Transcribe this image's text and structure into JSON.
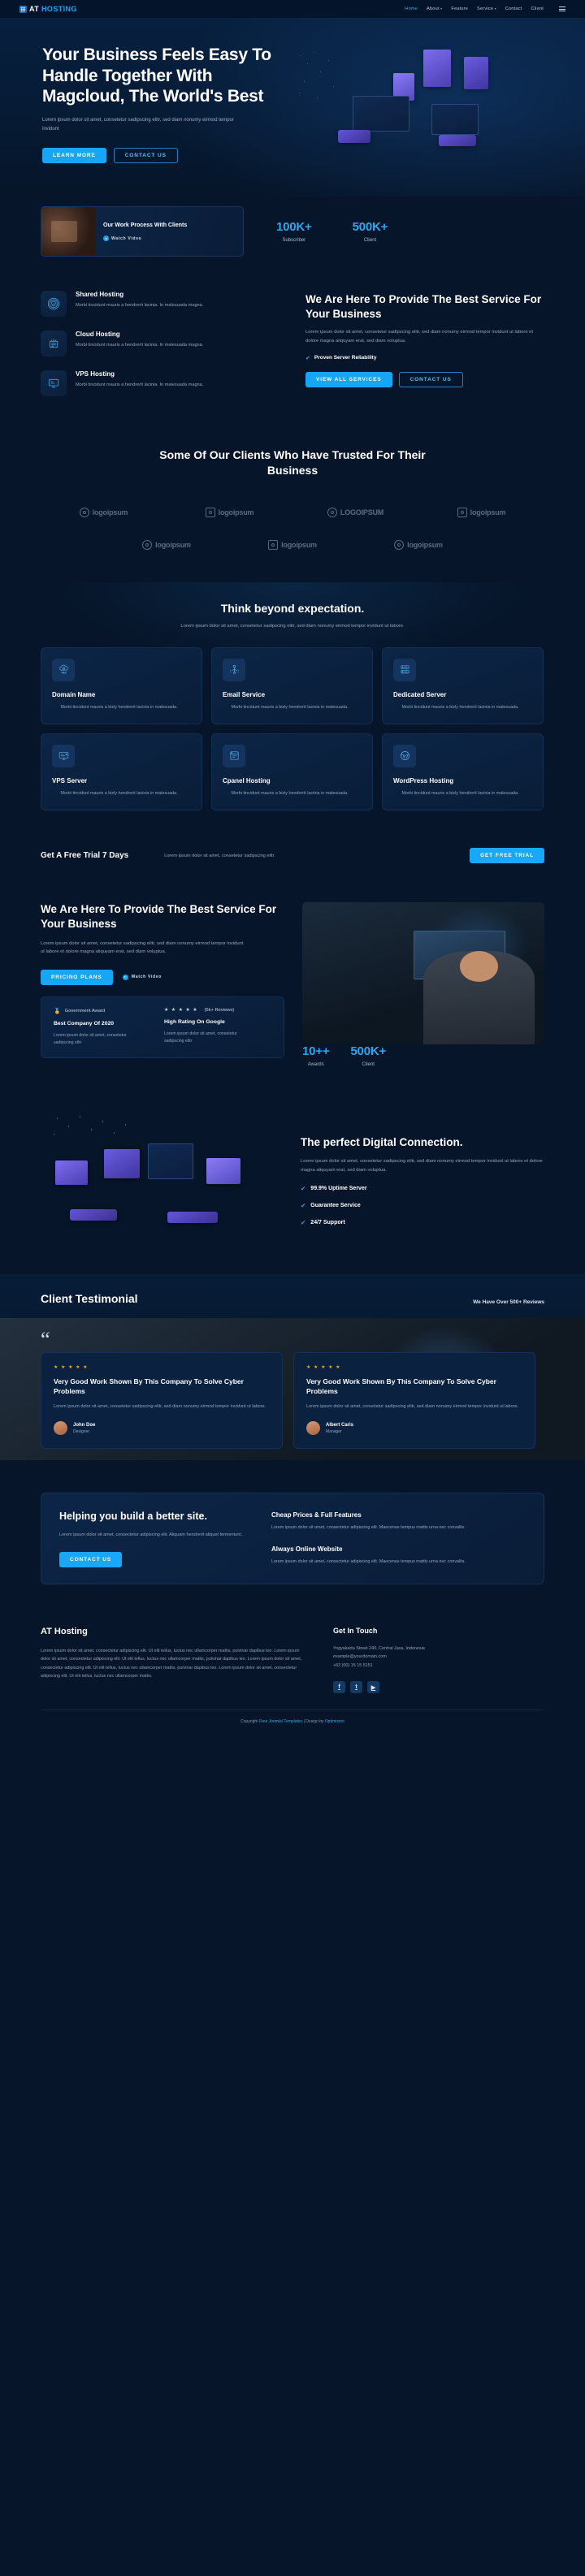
{
  "brand": {
    "name_a": "AT ",
    "name_b": "HOSTING"
  },
  "nav": {
    "items": [
      {
        "label": "Home",
        "active": true,
        "caret": false
      },
      {
        "label": "About",
        "active": false,
        "caret": true
      },
      {
        "label": "Feature",
        "active": false,
        "caret": false
      },
      {
        "label": "Service",
        "active": false,
        "caret": true
      },
      {
        "label": "Contact",
        "active": false,
        "caret": false
      },
      {
        "label": "Client",
        "active": false,
        "caret": false
      }
    ]
  },
  "hero": {
    "title": "Your Business Feels Easy To Handle Together With Magcloud, The World's Best",
    "desc": "Lorem ipsum dolor sit amet, consetetur sadipscing elitr, sed diam nonumy eirmod tempor invidunt",
    "btn_primary": "Learn More",
    "btn_outline": "Contact Us"
  },
  "band": {
    "video_title": "Our Work Process With Clients",
    "play_label": "Watch Video",
    "stats": [
      {
        "num": "100K+",
        "label": "Subscriber"
      },
      {
        "num": "500K+",
        "label": "Client"
      }
    ]
  },
  "services": {
    "items": [
      {
        "title": "Shared Hosting",
        "desc": "Morbi tincidunt mauris a hendrerit lacinia. In malesuada magna.",
        "icon": "shield-icon"
      },
      {
        "title": "Cloud Hosting",
        "desc": "Morbi tincidunt mauris a hendrerit lacinia. In malesuada magna.",
        "icon": "server-rack-icon"
      },
      {
        "title": "VPS Hosting",
        "desc": "Morbi tincidunt mauris a hendrerit lacinia. In malesuada magna.",
        "icon": "monitor-icon"
      }
    ],
    "heading": "We Are Here To Provide The Best Service For Your Business",
    "desc": "Lorem ipsum dolor sit amet, consetetur sadipscing elitr, sed diam nonumy eirmod tempor invidunt ut labore et dolore magna aliquyam erat, sed diam voluptua.",
    "check": "Proven Server Reliability",
    "btn_primary": "View All Services",
    "btn_outline": "Contact Us"
  },
  "clients": {
    "heading": "Some Of Our Clients Who Have Trusted For Their Business",
    "logos": [
      {
        "word": "logoipsum",
        "shape": "circle"
      },
      {
        "word": "logoipsum",
        "shape": "square"
      },
      {
        "word": "LOGOIPSUM",
        "shape": "circle"
      },
      {
        "word": "logoipsum",
        "shape": "square"
      },
      {
        "word": "logoipsum",
        "shape": "circle"
      },
      {
        "word": "logoipsum",
        "shape": "square"
      },
      {
        "word": "logoipsum",
        "shape": "circle"
      }
    ]
  },
  "think": {
    "heading": "Think beyond expectation.",
    "desc": "Lorem ipsum dolor sit amet, consetetur sadipscing elitr, sed diam nonumy eirmod tempor invidunt ut labore.",
    "cards": [
      {
        "title": "Domain Name",
        "desc": "Morbi tincidunt mauris a bizly hendrerit lacinia in malesuada.",
        "icon": "cloud-domain-icon"
      },
      {
        "title": "Email Service",
        "desc": "Morbi tincidunt mauris a bizly hendrerit lacinia in malesuada.",
        "icon": "email-network-icon"
      },
      {
        "title": "Dedicated Server",
        "desc": "Morbi tincidunt mauris a bizly hendrerit lacinia in malesuada.",
        "icon": "dedicated-server-icon"
      },
      {
        "title": "VPS Server",
        "desc": "Morbi tincidunt mauris a bizly hendrerit lacinia in malesuada.",
        "icon": "vps-server-icon"
      },
      {
        "title": "Cpanel Hosting",
        "desc": "Morbi tincidunt mauris a bizly hendrerit lacinia in malesuada.",
        "icon": "cpanel-icon"
      },
      {
        "title": "WordPress Hosting",
        "desc": "Morbi tincidunt mauris a bizly hendrerit lacinia in malesuada.",
        "icon": "wordpress-icon"
      }
    ]
  },
  "trial": {
    "heading": "Get A Free Trial 7 Days",
    "desc": "Lorem ipsum dolor sit amet, consetetur sadipscing elitr",
    "button": "Get Free Trial"
  },
  "provide": {
    "heading": "We Are Here To Provide The Best Service For Your Business",
    "desc": "Lorem ipsum dolor sit amet, consetetur sadipscing elitr, sed diam nonumy eirmod tempor invidunt ut labore et dolore magna aliquyam erat, sed diam voluptua.",
    "btn_primary": "Pricing Plans",
    "watch_label": "Watch Video",
    "awards": [
      {
        "badge": "Government Award",
        "title": "Best Company Of 2020",
        "desc": "Lorem ipsum dolor sit amet, consetetur sadipscing elitr",
        "icon": "medal-icon"
      },
      {
        "badge": "(5k+ Reviews)",
        "title": "High Rating On Google",
        "desc": "Lorem ipsum dolor sit amet, consetetur sadipscing elitr",
        "icon": "stars-icon",
        "stars": "★ ★ ★ ★ ★"
      }
    ],
    "stats": [
      {
        "num": "10++",
        "label": "Awards"
      },
      {
        "num": "500K+",
        "label": "Client"
      }
    ]
  },
  "digital": {
    "heading": "The perfect Digital Connection.",
    "desc": "Lorem ipsum dolor sit amet, consetetur sadipscing elitr, sed diam nonumy eirmod tempor invidunt ut labore et dolore magna aliquyam erat, sed diam voluptua.",
    "checks": [
      "99.9% Uptime Server",
      "Guarantee Service",
      "24/7 Support"
    ]
  },
  "testimonial": {
    "heading": "Client Testimonial",
    "sub": "We Have Over 500+ Reviews",
    "quote_glyph": "“",
    "cards": [
      {
        "stars": "★ ★ ★ ★ ★",
        "title": "Very Good Work Shown By This Company To Solve Cyber Problems",
        "desc": "Lorem ipsum dolor sit amet, consetetur sadipscing elitr, sed diam nonumy eirmod tempor invidunt ut labore.",
        "name": "John Doe",
        "role": "Designer"
      },
      {
        "stars": "★ ★ ★ ★ ★",
        "title": "Very Good Work Shown By This Company To Solve Cyber Problems",
        "desc": "Lorem ipsum dolor sit amet, consetetur sadipscing elitr, sed diam nonumy eirmod tempor invidunt ut labore.",
        "name": "Albert Caris",
        "role": "Manager"
      }
    ]
  },
  "help": {
    "heading": "Helping you build a better site.",
    "desc": "Lorem ipsum dolor sit amet, consectetur adipiscing elit. Aliquam hendrerit aliquet fermentum.",
    "button": "Contact Us",
    "blocks": [
      {
        "title": "Cheap Prices & Full Features",
        "desc": "Lorem ipsum dolor sit amet, consectetur adipiscing elit. Maecenas tempus mattis urna nec convallis."
      },
      {
        "title": "Always Online Website",
        "desc": "Lorem ipsum dolor sit amet, consectetur adipiscing elit. Maecenas tempus mattis urna nec convallis."
      }
    ]
  },
  "footer": {
    "brand": "AT Hosting",
    "about": "Lorem ipsum dolor sit amet, consectetur adipiscing elit. Ut elit tellus, luctus nec ullamcorper mattis, pulvinar dapibus leo. Lorem ipsum dolor sit amet, consectetur adipiscing elit. Ut elit tellus, luctus nec ullamcorper mattis, pulvinar dapibus leo. Lorem ipsum dolor sit amet, consectetur adipiscing elit. Ut elit tellus, luctus nec ullamcorper mattis, pulvinar dapibus leo. Lorem ipsum dolor sit amet, consectetur adipiscing elit. Ut elit tellus, luctus nec ullamcorper mattis.",
    "contact_title": "Get In Touch",
    "contact_lines": [
      "Yogyakarta Street 240, Central Java, Indonesia",
      "example@yourdomain.com",
      "+62 (00) 15 15 5151"
    ],
    "socials": [
      "facebook-icon",
      "twitter-icon",
      "youtube-icon"
    ],
    "copyright_pre": "Copyright ",
    "copyright_link": "Free Joomla! Templates",
    "copyright_mid": " | Design by ",
    "copyright_link2": "Optimismo"
  }
}
